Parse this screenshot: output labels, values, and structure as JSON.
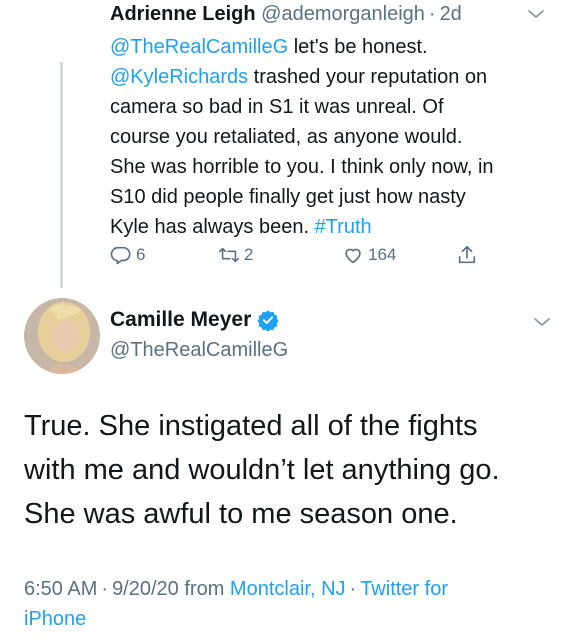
{
  "reply_tweet": {
    "name": "Adrienne Leigh",
    "handle": "@ademorganleigh",
    "separator": "·",
    "time": "2d",
    "mention1": "@TheRealCamilleG",
    "line1_rest": " let's be honest.",
    "mention2": "@KyleRichards",
    "line2_rest": " trashed your reputation on",
    "line3": "camera so bad in S1 it was unreal. Of",
    "line4": "course you retaliated, as anyone would.",
    "line5": "She was horrible to you. I think only now, in",
    "line6": "S10 did people finally get just how nasty",
    "line7_text": "Kyle has always been. ",
    "hashtag": "#Truth",
    "replies": "6",
    "retweets": "2",
    "likes": "164",
    "icons": [
      "reply-icon",
      "retweet-icon",
      "like-icon",
      "share-icon",
      "chevron-down-icon"
    ]
  },
  "main_tweet": {
    "name": "Camille Meyer",
    "handle": "@TheRealCamilleG",
    "verified": true,
    "text_line1": "True. She instigated all of the fights",
    "text_line2": "with me and wouldn’t let anything go.",
    "text_line3": "She was awful to me season one.",
    "time": "6:50 AM",
    "separator": "·",
    "date": "9/20/20",
    "from_label": " from ",
    "location": "Montclair, NJ",
    "source": "Twitter for",
    "source_line2": "iPhone"
  },
  "colors": {
    "text": "#14171a",
    "secondary": "#5b7083",
    "link": "#1da1f2",
    "thread_line": "#cfd9de"
  }
}
